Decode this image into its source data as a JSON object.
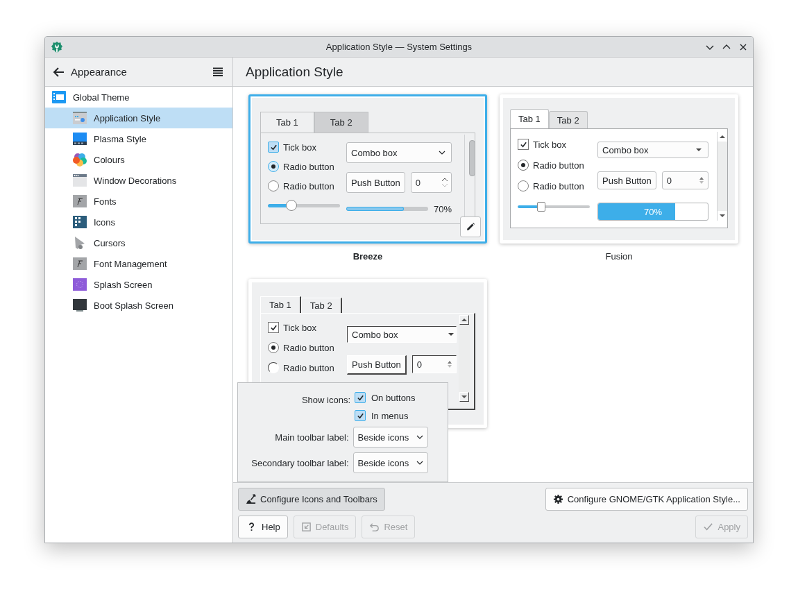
{
  "window": {
    "title": "Application Style — System Settings"
  },
  "sidebar": {
    "back_label": "Appearance",
    "items": [
      {
        "label": "Global Theme",
        "selected": false,
        "children": [
          {
            "label": "Application Style",
            "selected": true
          },
          {
            "label": "Plasma Style",
            "selected": false
          },
          {
            "label": "Colours",
            "selected": false
          },
          {
            "label": "Window Decorations",
            "selected": false
          },
          {
            "label": "Fonts",
            "selected": false
          },
          {
            "label": "Icons",
            "selected": false
          },
          {
            "label": "Cursors",
            "selected": false
          },
          {
            "label": "Font Management",
            "selected": false
          },
          {
            "label": "Splash Screen",
            "selected": false
          },
          {
            "label": "Boot Splash Screen",
            "selected": false
          }
        ]
      }
    ]
  },
  "page_title": "Application Style",
  "styles": [
    {
      "kind": "breeze",
      "name": "Breeze",
      "selected": true,
      "tabs": [
        {
          "label": "Tab 1",
          "selected": true
        },
        {
          "label": "Tab 2",
          "selected": false
        }
      ],
      "checkbox": {
        "label": "Tick box",
        "checked": true
      },
      "radios": [
        {
          "label": "Radio button",
          "selected": true
        },
        {
          "label": "Radio button",
          "selected": false
        }
      ],
      "combo": "Combo box",
      "push_button": "Push Button",
      "spin_value": "0",
      "slider": {
        "level": 0.3
      },
      "progress": {
        "level": 0.7,
        "reading": "70%"
      }
    },
    {
      "kind": "fusion",
      "name": "Fusion",
      "selected": false,
      "tabs": [
        {
          "label": "Tab 1",
          "selected": true
        },
        {
          "label": "Tab 2",
          "selected": false
        }
      ],
      "checkbox": {
        "label": "Tick box",
        "checked": true
      },
      "radios": [
        {
          "label": "Radio button",
          "selected": true
        },
        {
          "label": "Radio button",
          "selected": false
        }
      ],
      "combo": "Combo box",
      "push_button": "Push Button",
      "spin_value": "0",
      "slider": {
        "level": 0.3
      },
      "progress": {
        "level": 0.7,
        "reading": "70%"
      }
    },
    {
      "kind": "windows",
      "selected": false,
      "tabs": [
        {
          "label": "Tab 1",
          "selected": true
        },
        {
          "label": "Tab 2",
          "selected": false
        }
      ],
      "checkbox": {
        "label": "Tick box",
        "checked": true
      },
      "radios": [
        {
          "label": "Radio button",
          "selected": true
        },
        {
          "label": "Radio button",
          "selected": false
        }
      ],
      "combo": "Combo box",
      "push_button": "Push Button",
      "spin_value": "0"
    }
  ],
  "popup": {
    "show_icons": {
      "label": "Show icons:",
      "options": [
        {
          "label": "On buttons",
          "checked": true
        },
        {
          "label": "In menus",
          "checked": true
        }
      ]
    },
    "combos": [
      {
        "label": "Main toolbar label:",
        "value": "Beside icons"
      },
      {
        "label": "Secondary toolbar label:",
        "value": "Beside icons"
      }
    ]
  },
  "actions": {
    "configure_icons": {
      "label": "Configure Icons and Toolbars",
      "pressed": true
    },
    "configure_gtk": {
      "label": "Configure GNOME/GTK Application Style..."
    }
  },
  "footer": [
    {
      "kind": "help",
      "label": "Help",
      "disabled": false
    },
    {
      "kind": "defaults",
      "label": "Defaults",
      "disabled": true
    },
    {
      "kind": "reset",
      "label": "Reset",
      "disabled": true
    },
    {
      "kind": "apply",
      "label": "Apply",
      "disabled": true
    }
  ]
}
